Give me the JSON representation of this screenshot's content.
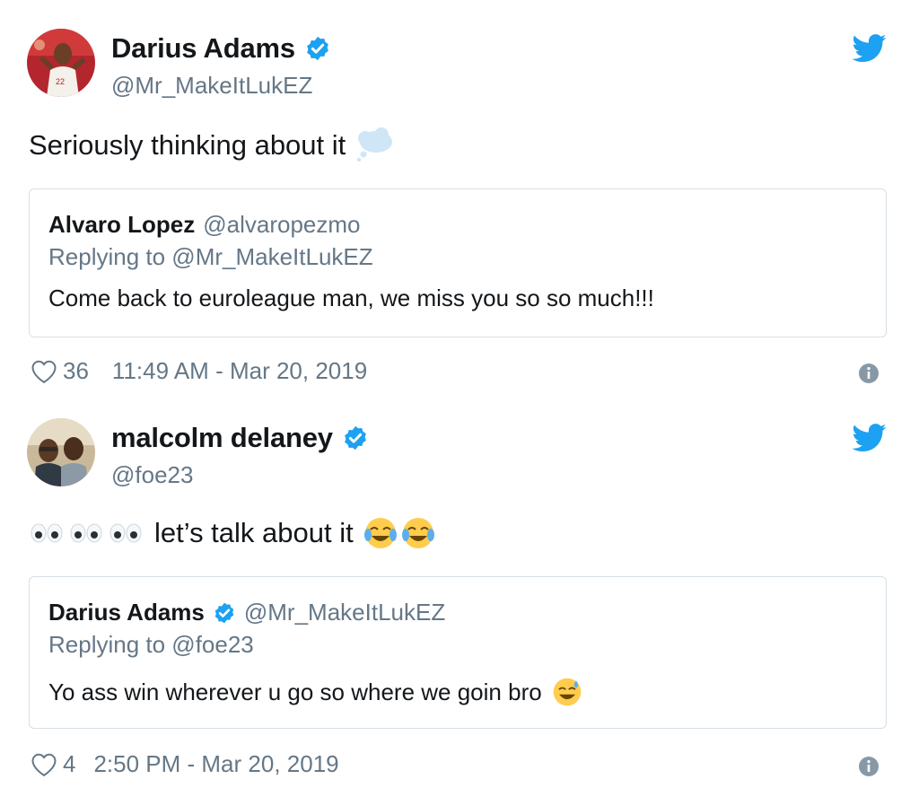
{
  "tweets": [
    {
      "author": {
        "name": "Darius Adams",
        "handle": "@Mr_MakeItLukEZ",
        "avatar": "avatar-basketball-player",
        "verified": true
      },
      "text": "Seriously thinking about it",
      "text_emoji": "thought-balloon-icon",
      "quote": {
        "name": "Alvaro Lopez",
        "handle": "@alvaropezmo",
        "replying_to": "Replying to @Mr_MakeItLukEZ",
        "text": "Come back to euroleague man, we miss you so so much!!!"
      },
      "likes": "36",
      "timestamp": "11:49 AM - Mar 20, 2019"
    },
    {
      "author": {
        "name": "malcolm delaney",
        "handle": "@foe23",
        "avatar": "avatar-two-men-selfie",
        "verified": true
      },
      "text": "let’s talk about it",
      "text_emoji": "eyes-icon x3, tears-of-joy-icon x2",
      "quote": {
        "name": "Darius Adams",
        "handle": "@Mr_MakeItLukEZ",
        "verified": true,
        "replying_to": "Replying to @foe23",
        "text": "Yo ass win wherever u go so where we goin bro",
        "text_emoji": "grinning-sweat-icon"
      },
      "likes": "4",
      "timestamp": "2:50 PM - Mar 20, 2019"
    }
  ],
  "colors": {
    "verified_blue": "#1da1f2",
    "twitter_blue": "#1da1f2",
    "muted": "#657786",
    "border": "#d6dfe5",
    "text": "#14171a"
  }
}
